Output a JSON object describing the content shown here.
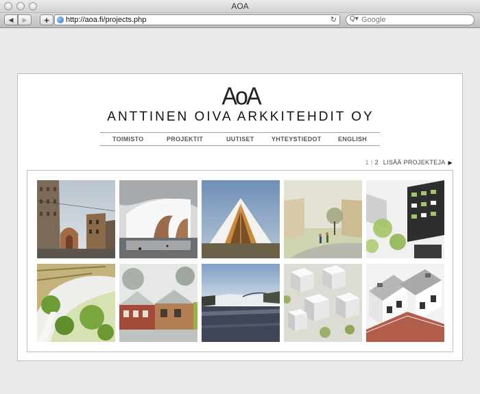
{
  "window": {
    "title": "AOA"
  },
  "toolbar": {
    "back_glyph": "◀",
    "forward_glyph": "▶",
    "add_glyph": "+",
    "url": "http://aoa.fi/projects.php",
    "reload_glyph": "↻",
    "search_placeholder": "Google",
    "search_glyph": "Q▾"
  },
  "site": {
    "logo": "AoA",
    "company_name": "ANTTINEN OIVA ARKKITEHDIT OY",
    "nav": [
      "TOIMISTO",
      "PROJEKTIT",
      "UUTISET",
      "YHTEYSTIEDOT",
      "ENGLISH"
    ]
  },
  "pager": {
    "page1": "1",
    "separator": "|",
    "page2": "2",
    "more_label": "LISÄÄ PROJEKTEJA",
    "arrow": "▶"
  },
  "gallery": {
    "items": [
      {
        "subject": "city-street-church"
      },
      {
        "subject": "white-curved-pavilion"
      },
      {
        "subject": "white-gable-chapel"
      },
      {
        "subject": "village-street-people"
      },
      {
        "subject": "apartment-block-trees"
      },
      {
        "subject": "curved-housing-courtyard"
      },
      {
        "subject": "brick-timber-houses"
      },
      {
        "subject": "river-bridge-winter"
      },
      {
        "subject": "white-cube-village"
      },
      {
        "subject": "white-gable-townhouses"
      }
    ]
  }
}
